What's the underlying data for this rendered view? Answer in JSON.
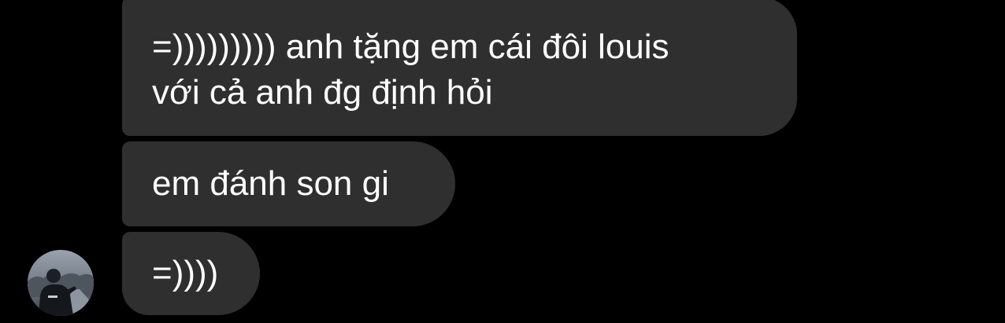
{
  "messages": [
    {
      "text": "=))))))))) anh tặng em cái đôi louis\nvới cả anh đg định hỏi"
    },
    {
      "text": "em đánh son gi"
    },
    {
      "text": "=))))"
    }
  ],
  "colors": {
    "background": "#000000",
    "bubble": "#2f2f2f",
    "text": "#ffffff"
  },
  "avatar": {
    "icon": "user-photo-avatar"
  }
}
